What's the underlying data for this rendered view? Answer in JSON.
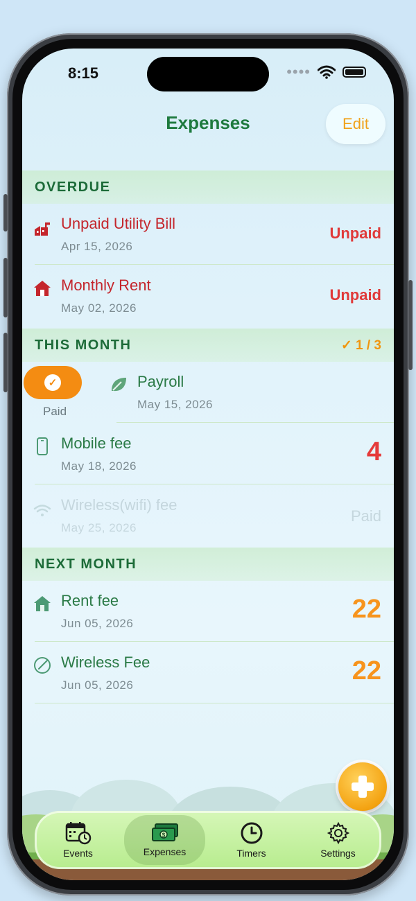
{
  "status": {
    "time": "8:15"
  },
  "header": {
    "title": "Expenses",
    "edit_label": "Edit"
  },
  "sections": {
    "overdue": {
      "label": "OVERDUE"
    },
    "this_month": {
      "label": "THIS MONTH",
      "count": "✓ 1 / 3"
    },
    "next_month": {
      "label": "NEXT MONTH"
    }
  },
  "overdue_items": [
    {
      "title": "Unpaid Utility Bill",
      "date": "Apr 15, 2026",
      "status": "Unpaid",
      "icon": "building-icon"
    },
    {
      "title": "Monthly Rent",
      "date": "May 02, 2026",
      "status": "Unpaid",
      "icon": "house-icon"
    }
  ],
  "this_month_items": [
    {
      "title": "Payroll",
      "date": "May 15, 2026",
      "icon": "leaf-icon",
      "swipe_action": "Paid"
    },
    {
      "title": "Mobile fee",
      "date": "May 18, 2026",
      "value": "4",
      "icon": "phone-icon"
    },
    {
      "title": "Wireless(wifi) fee",
      "date": "May 25, 2026",
      "status": "Paid",
      "icon": "wifi-icon"
    }
  ],
  "next_month_items": [
    {
      "title": "Rent fee",
      "date": "Jun 05, 2026",
      "value": "22",
      "icon": "house-icon"
    },
    {
      "title": "Wireless Fee",
      "date": "Jun 05, 2026",
      "value": "22",
      "icon": "gauge-icon"
    }
  ],
  "tabs": [
    {
      "label": "Events",
      "icon": "calendar-clock-icon"
    },
    {
      "label": "Expenses",
      "icon": "money-icon",
      "active": true
    },
    {
      "label": "Timers",
      "icon": "clock-icon"
    },
    {
      "label": "Settings",
      "icon": "gear-icon"
    }
  ],
  "colors": {
    "accent": "#f0a21a",
    "title_green": "#1e7a3e",
    "overdue_red": "#c4262c",
    "unpaid_red": "#e03a3a",
    "count_orange": "#f7941d"
  }
}
